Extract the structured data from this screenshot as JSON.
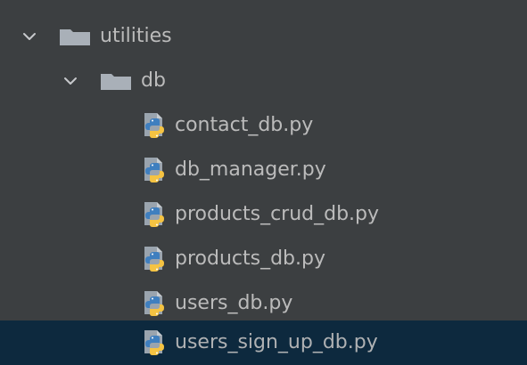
{
  "tree": {
    "items": [
      {
        "label": "utilities",
        "type": "folder",
        "expanded": true,
        "icon": "folder-icon"
      },
      {
        "label": "db",
        "type": "folder",
        "expanded": true,
        "icon": "folder-icon"
      },
      {
        "label": "contact_db.py",
        "type": "python-file",
        "icon": "python-file-icon"
      },
      {
        "label": "db_manager.py",
        "type": "python-file",
        "icon": "python-file-icon"
      },
      {
        "label": "products_crud_db.py",
        "type": "python-file",
        "icon": "python-file-icon"
      },
      {
        "label": "products_db.py",
        "type": "python-file",
        "icon": "python-file-icon"
      },
      {
        "label": "users_db.py",
        "type": "python-file",
        "icon": "python-file-icon"
      },
      {
        "label": "users_sign_up_db.py",
        "type": "python-file",
        "icon": "python-file-icon",
        "selected": true
      }
    ]
  },
  "colors": {
    "background": "#3c3f41",
    "text": "#bbbbbb",
    "selection": "#0d293e",
    "folder": "#a9b0b8",
    "python_blue": "#3f7fbf",
    "python_yellow": "#f5c342"
  }
}
